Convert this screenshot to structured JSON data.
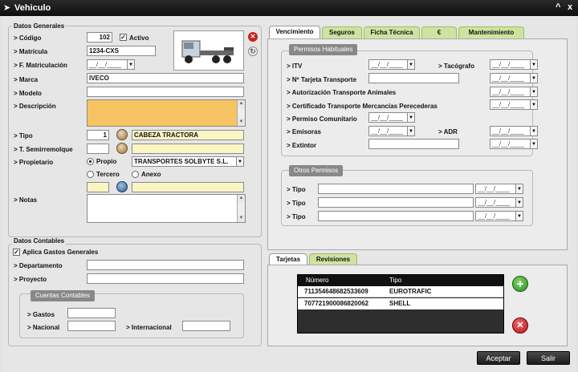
{
  "window": {
    "title": "Vehiculo",
    "minimize": "^",
    "close": "x"
  },
  "datos_generales": {
    "legend": "Datos Generales",
    "codigo_label": "> Código",
    "codigo": "102",
    "activo_label": "Activo",
    "matricula_label": "> Matrícula",
    "matricula": "1234-CXS",
    "f_matriculacion_label": "> F. Matriculación",
    "f_matriculacion": "__/__/____",
    "marca_label": "> Marca",
    "marca": "IVECO",
    "modelo_label": "> Modelo",
    "modelo": "",
    "descripcion_label": "> Descripción",
    "descripcion": "",
    "tipo_label": "> Tipo",
    "tipo_codigo": "1",
    "tipo_nombre": "CABEZA TRACTORA",
    "semirremolque_label": "> T. Semirremolque",
    "semirremolque_codigo": "",
    "semirremolque_nombre": "",
    "propietario_label": "> Propietario",
    "propio_label": "Propio",
    "propietario_nombre": "TRANSPORTES SOLBYTE S.L.",
    "tercero_label": "Tercero",
    "anexo_label": "Anexo",
    "tercero_codigo": "",
    "tercero_nombre": "",
    "notas_label": "> Notas",
    "notas": ""
  },
  "datos_contables": {
    "legend": "Datos Contables",
    "aplica_label": "Aplica Gastos Generales",
    "departamento_label": "> Departamento",
    "departamento": "",
    "proyecto_label": "> Proyecto",
    "proyecto": "",
    "cuentas_label": "Cuentas Contables",
    "gastos_label": "> Gastos",
    "gastos": "",
    "nacional_label": "> Nacional",
    "nacional": "",
    "internacional_label": "> Internacional",
    "internacional": ""
  },
  "tabs": [
    "Vencimiento",
    "Seguros",
    "Ficha Técnica",
    "€",
    "Mantenimiento"
  ],
  "vencimiento": {
    "habituales_label": "Permisos Habituales",
    "itv_label": "> ITV",
    "itv": "__/__/____",
    "tacografo_label": "> Tacógrafo",
    "tacografo": "__/__/____",
    "tarjeta_label": "> Nº Tarjeta Transporte",
    "tarjeta": "",
    "tarjeta_fecha": "__/__/____",
    "autorizacion_label": "> Autorización Transporte Animales",
    "autorizacion": "__/__/____",
    "mercancias_label": "> Certificado Transporte Mercancías Perecederas",
    "mercancias": "__/__/____",
    "comunitario_label": "> Permiso Comunitario",
    "comunitario": "__/__/____",
    "emisoras_label": "> Emisoras",
    "emisoras": "__/__/____",
    "adr_label": "> ADR",
    "adr": "__/__/____",
    "extintor_label": "> Extintor",
    "extintor": "",
    "extintor_fecha": "__/__/____",
    "otros_label": "Otros Permisos",
    "tipo_label": "> Tipo",
    "otros": [
      {
        "valor": "",
        "fecha": "__/__/____"
      },
      {
        "valor": "",
        "fecha": "__/__/____"
      },
      {
        "valor": "",
        "fecha": "__/__/____"
      }
    ]
  },
  "tarjetas": {
    "tabs": [
      "Tarjetas",
      "Revisiones"
    ],
    "columns": [
      "Número",
      "Tipo"
    ],
    "rows": [
      {
        "numero": "711354648682533609",
        "tipo": "EUROTRAFIC"
      },
      {
        "numero": "707721900086820062",
        "tipo": "SHELL"
      }
    ]
  },
  "buttons": {
    "aceptar": "Aceptar",
    "salir": "Salir"
  },
  "colors": {
    "accent_tab": "#cfe3a0",
    "required_field": "#f6c463",
    "lookup_field": "#fbf5c4",
    "add_button": "#3a9a2a",
    "delete_button": "#c62222"
  }
}
